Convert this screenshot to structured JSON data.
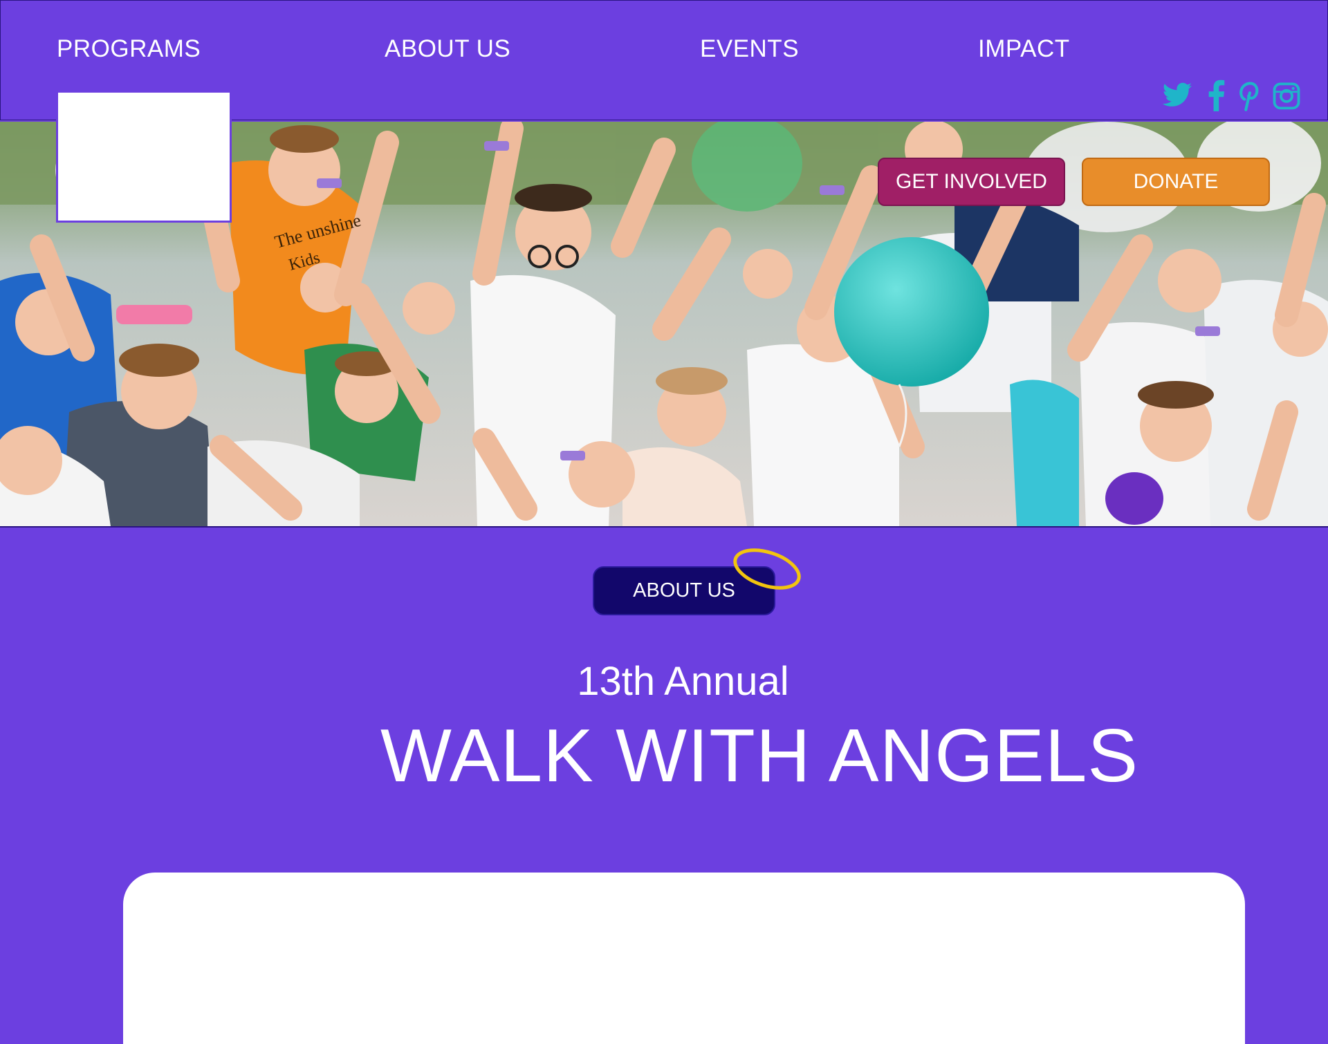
{
  "nav": {
    "items": [
      {
        "label": "PROGRAMS"
      },
      {
        "label": "ABOUT US"
      },
      {
        "label": "EVENTS"
      },
      {
        "label": "IMPACT"
      }
    ]
  },
  "social": {
    "icons": [
      "twitter-icon",
      "facebook-icon",
      "pinterest-icon",
      "instagram-icon"
    ],
    "color": "#1fb5c9"
  },
  "hero": {
    "buttons": {
      "get_involved": "GET INVOLVED",
      "donate": "DONATE"
    }
  },
  "about": {
    "pill_label": "ABOUT US"
  },
  "event": {
    "subtitle": "13th Annual",
    "title": "WALK WITH ANGELS"
  },
  "colors": {
    "background": "#6c3fe0",
    "get_involved": "#a01f66",
    "donate": "#e88d2a",
    "pill": "#12076b",
    "halo": "#f2c40f"
  }
}
